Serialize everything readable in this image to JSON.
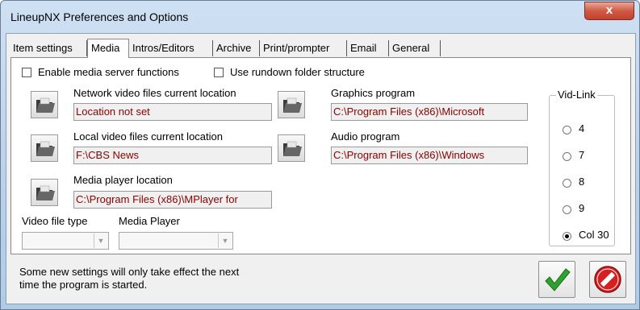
{
  "window": {
    "title": "LineupNX Preferences and Options",
    "close_glyph": "x"
  },
  "tabs": [
    {
      "label": "Item settings"
    },
    {
      "label": "Media"
    },
    {
      "label": "Intros/Editors"
    },
    {
      "label": "Archive"
    },
    {
      "label": "Print/prompter"
    },
    {
      "label": "Email"
    },
    {
      "label": "General"
    }
  ],
  "active_tab": "Media",
  "checkboxes": {
    "media_server": {
      "label": "Enable media server functions",
      "checked": false
    },
    "rundown_folder": {
      "label": "Use rundown folder structure",
      "checked": false
    }
  },
  "locations": {
    "network_video": {
      "label": "Network video files current location",
      "value": "Location not set"
    },
    "local_video": {
      "label": "Local video files current location",
      "value": "F:\\CBS News"
    },
    "media_player": {
      "label": "Media player location",
      "value": "C:\\Program Files (x86)\\MPlayer for"
    },
    "graphics": {
      "label": "Graphics program",
      "value": "C:\\Program Files (x86)\\Microsoft"
    },
    "audio": {
      "label": "Audio program",
      "value": "C:\\Program Files (x86)\\Windows"
    }
  },
  "dropdowns": {
    "video_file_type": {
      "label": "Video file type",
      "value": ""
    },
    "media_player": {
      "label": "Media Player",
      "value": ""
    }
  },
  "vid_link": {
    "title": "Vid-Link",
    "options": [
      "4",
      "7",
      "8",
      "9",
      "Col 30"
    ],
    "selected": "Col 30"
  },
  "footer": {
    "message_line1": "Some new settings will only take effect the next",
    "message_line2": "time the program is started."
  },
  "icons": {
    "folder": "folder-icon",
    "ok": "green-checkmark-icon",
    "cancel": "red-no-entry-icon"
  },
  "colors": {
    "path_text": "#8b0000",
    "ok_green": "#2fa12f",
    "cancel_red": "#d42020"
  }
}
